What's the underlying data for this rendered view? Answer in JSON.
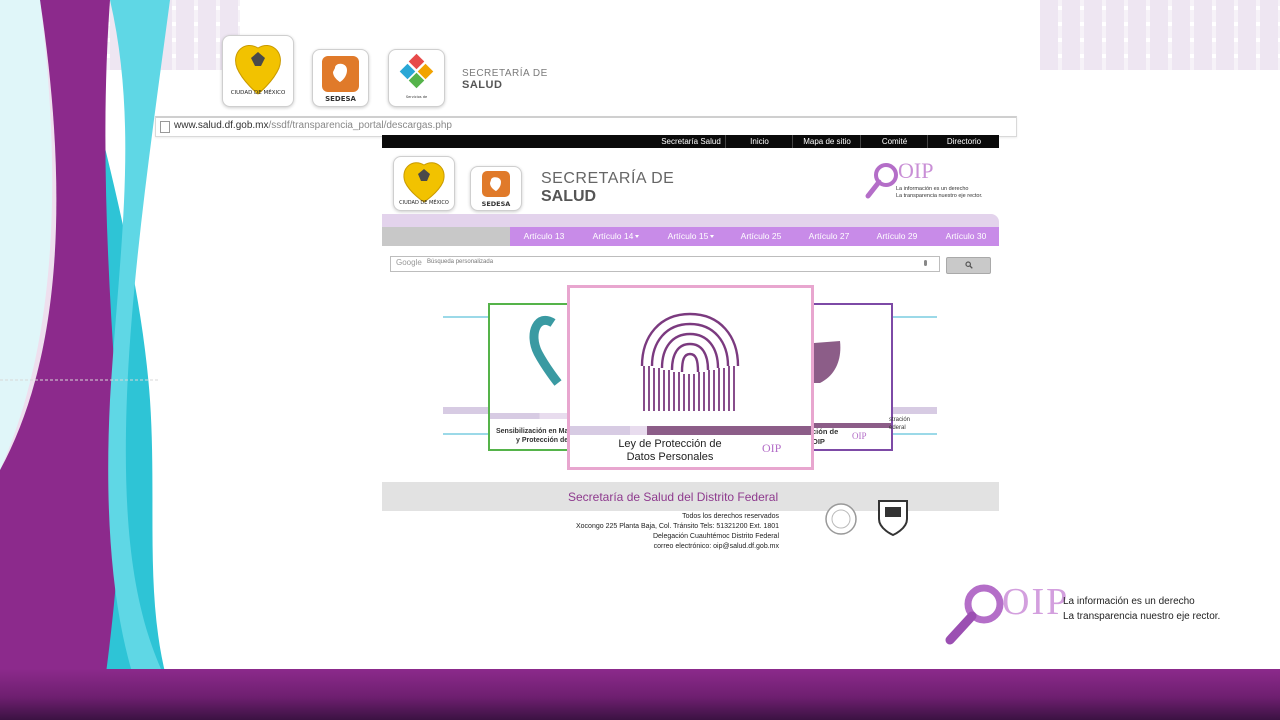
{
  "header": {
    "logos": [
      "CIUDAD DE MÉXICO",
      "SEDESA",
      "Servicios de Salud Pública del DF"
    ],
    "title_line1": "SECRETARÍA DE",
    "title_line2": "SALUD",
    "cdmx_sub": "Decidiendo Juntos"
  },
  "browser": {
    "url_domain": "www.salud.df.gob.mx",
    "url_path": "/ssdf/transparencia_portal/descargas.php"
  },
  "site": {
    "topnav": [
      "Secretaría Salud",
      "Inicio",
      "Mapa de sitio",
      "Comité",
      "Directorio"
    ],
    "title_line1": "SECRETARÍA DE",
    "title_line2": "SALUD",
    "oip_label": "OIP",
    "oip_tag1": "La información es un derecho",
    "oip_tag2": "La transparencia nuestro eje rector.",
    "tabs": [
      "Artículo 13",
      "Artículo 14",
      "Artículo 15",
      "Artículo 25",
      "Artículo 27",
      "Artículo 29",
      "Artículo 30"
    ],
    "search_placeholder": "Búsqueda personalizada",
    "search_brand": "Google",
    "carousel": {
      "left_label1": "Sensibilización en Ma",
      "left_label2": "y Protección de",
      "center_title1": "Ley de Protección de",
      "center_title2": "Datos Personales",
      "right_label1": "ción de",
      "right_label2": "OIP",
      "far_right1": "stración",
      "far_right2": "ederal"
    },
    "footer": {
      "title": "Secretaría de Salud del  Distrito Federal",
      "line1": "Todos los derechos reservados",
      "line2": "Xocongo 225 Planta Baja, Col. Tránsito Tels: 51321200 Ext. 1801",
      "line3": "Delegación Cuauhtémoc Distrito Federal",
      "line4": "correo electrónico: oip@salud.df.gob.mx"
    }
  },
  "slide": {
    "oip_label": "OIP",
    "tagline1": "La información es un derecho",
    "tagline2": "La transparencia nuestro eje rector."
  },
  "colors": {
    "purple": "#8c2a8c",
    "teal": "#2ec4d6",
    "lavender": "#c88be8",
    "pink_frame": "#e8a6cf"
  }
}
